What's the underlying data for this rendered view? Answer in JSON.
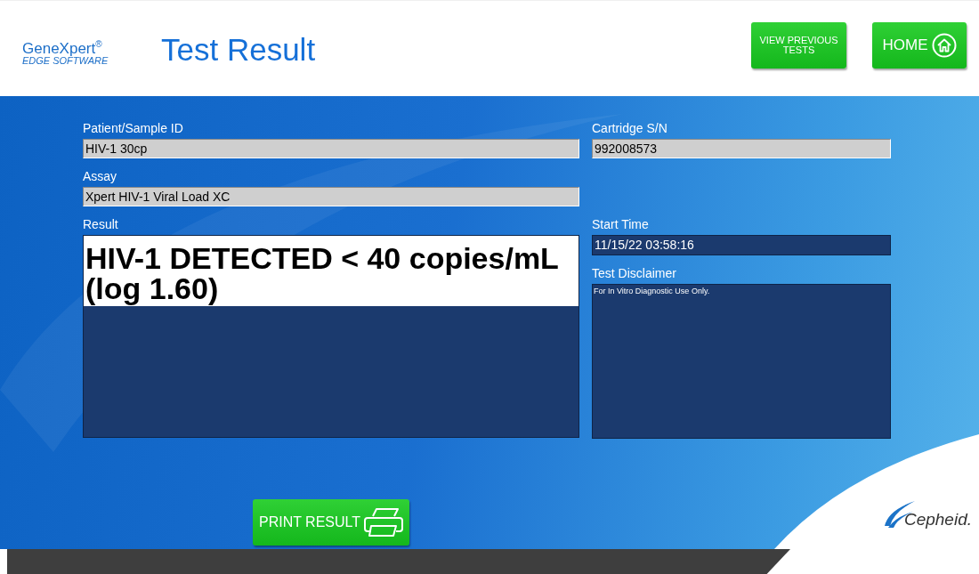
{
  "header": {
    "logo": {
      "name": "GeneXpert$^{®}$",
      "tagline": "EDGE SOFTWARE"
    },
    "title": "Test Result",
    "buttons": [
      {
        "label": "VIEW PREVIOUS TESTS",
        "kind": "text"
      },
      {
        "label": "HOME",
        "kind": "home"
      }
    ]
  },
  "patient_sample_id": {
    "label": "Patient/Sample ID",
    "value": "HIV-1 30cp"
  },
  "cartridge_sn": {
    "label": "Cartridge S/N",
    "value": "992008573"
  },
  "assay": {
    "label": "Assay",
    "value": "Xpert HIV-1 Viral Load XC"
  },
  "result": {
    "label": "Result",
    "value": "HIV-1 DETECTED < 40 copies/mL (log 1.60)"
  },
  "start_time": {
    "label": "Start Time",
    "value": "11/15/22 03:58:16"
  },
  "test_disclaimer": {
    "label": "Test Disclaimer",
    "value": "For In Vitro Diagnostic Use Only."
  },
  "print_button": {
    "label": "PRINT RESULT"
  },
  "footer": {
    "brand": "Cepheid."
  }
}
